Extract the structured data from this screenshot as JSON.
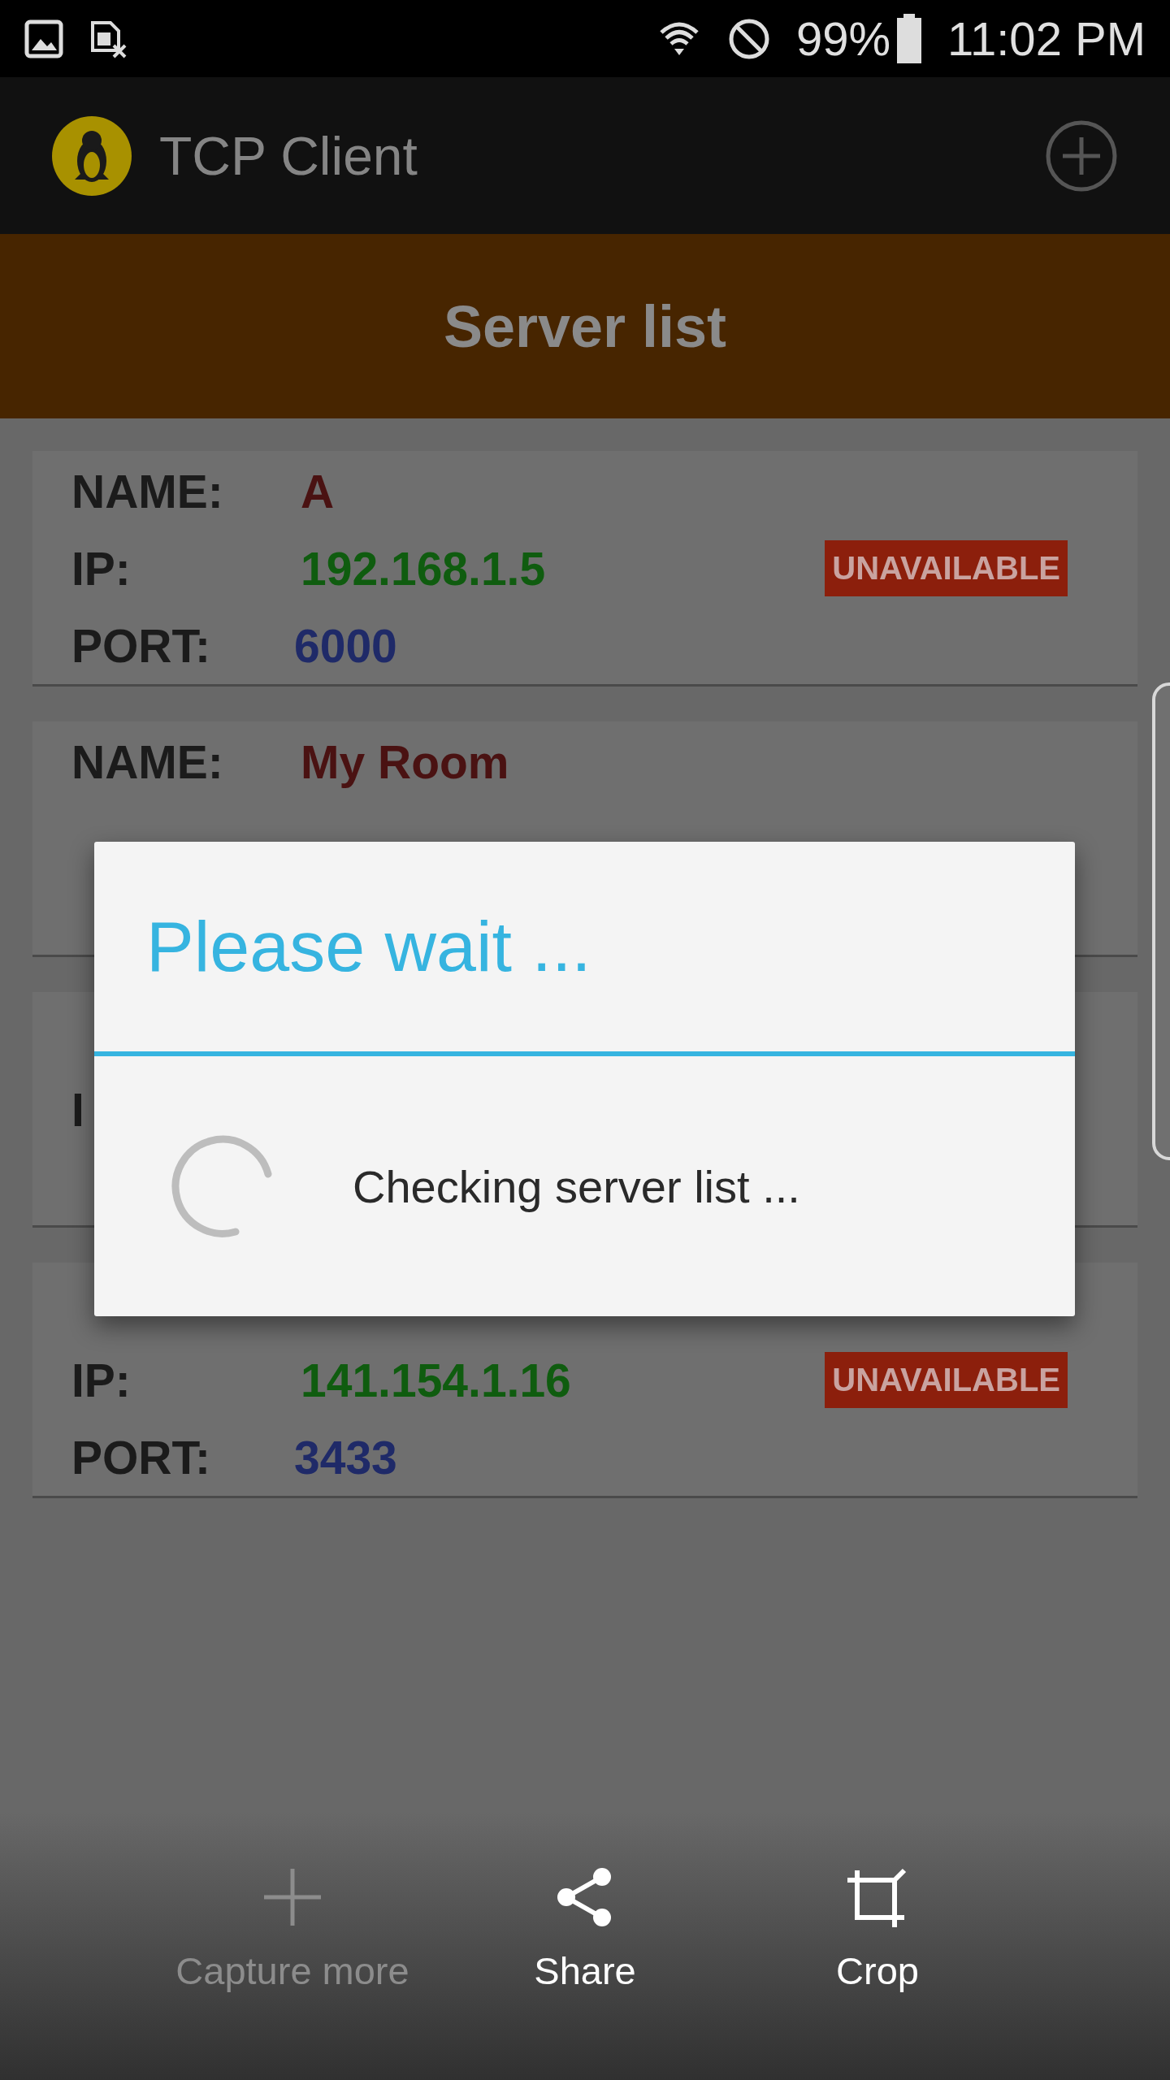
{
  "status_bar": {
    "battery": "99%",
    "time": "11:02 PM"
  },
  "app_bar": {
    "title": "TCP Client"
  },
  "header": {
    "title": "Server list"
  },
  "servers": [
    {
      "name_label": "NAME:",
      "name": "A",
      "ip_label": "IP:",
      "ip": "192.168.1.5",
      "port_label": "PORT:",
      "port": "6000",
      "badge": "UNAVAILABLE"
    },
    {
      "name_label": "NAME:",
      "name": "My Room"
    },
    {
      "ip_label": "I"
    },
    {
      "ip_label": "IP:",
      "ip": "141.154.1.16",
      "port_label": "PORT:",
      "port": "3433",
      "badge": "UNAVAILABLE"
    }
  ],
  "dialog": {
    "title": "Please wait ...",
    "message": "Checking server list ..."
  },
  "toolbar": [
    {
      "label": "Capture more",
      "kind": "add",
      "disabled": true
    },
    {
      "label": "Share",
      "kind": "share",
      "disabled": false
    },
    {
      "label": "Crop",
      "kind": "crop",
      "disabled": false
    }
  ]
}
